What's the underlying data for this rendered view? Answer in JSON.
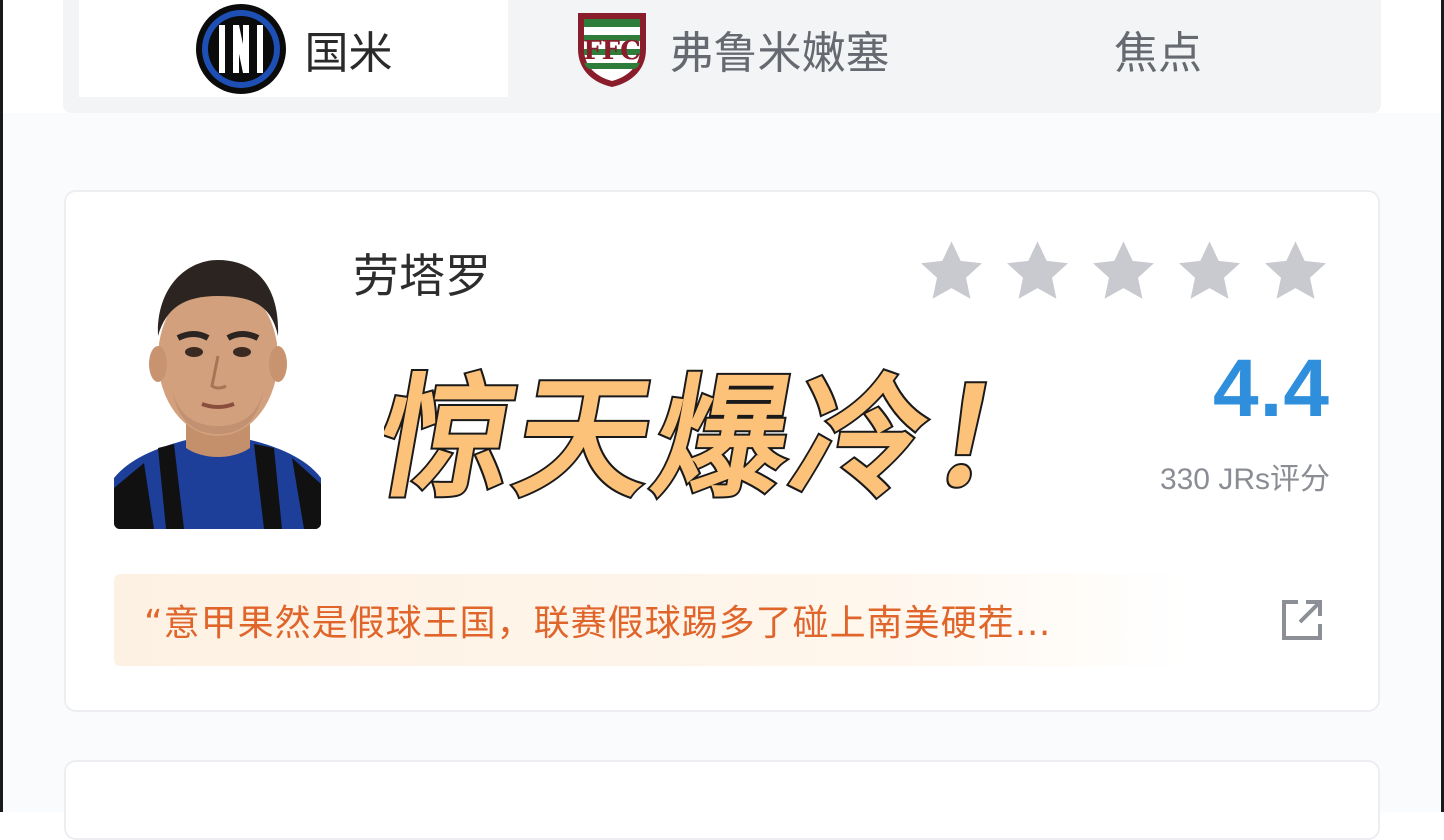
{
  "tabs": [
    {
      "label": "国米",
      "active": true,
      "icon": "inter-milan-logo-icon"
    },
    {
      "label": "弗鲁米嫩塞",
      "active": false,
      "icon": "fluminense-logo-icon"
    },
    {
      "label": "焦点",
      "active": false
    }
  ],
  "player": {
    "name": "劳塔罗",
    "rating": "4.4",
    "rating_count": "330 JRs评分",
    "stars_total": 5,
    "stars_selected": 0,
    "headline": "惊天爆冷！",
    "comment": "“意甲果然是假球王国，联赛假球踢多了碰上南美硬茬…"
  },
  "colors": {
    "rating_blue": "#2f8fdd",
    "comment_orange": "#e0652b",
    "star_gray": "#c8cad0",
    "headline_fill": "#fcc27a"
  }
}
